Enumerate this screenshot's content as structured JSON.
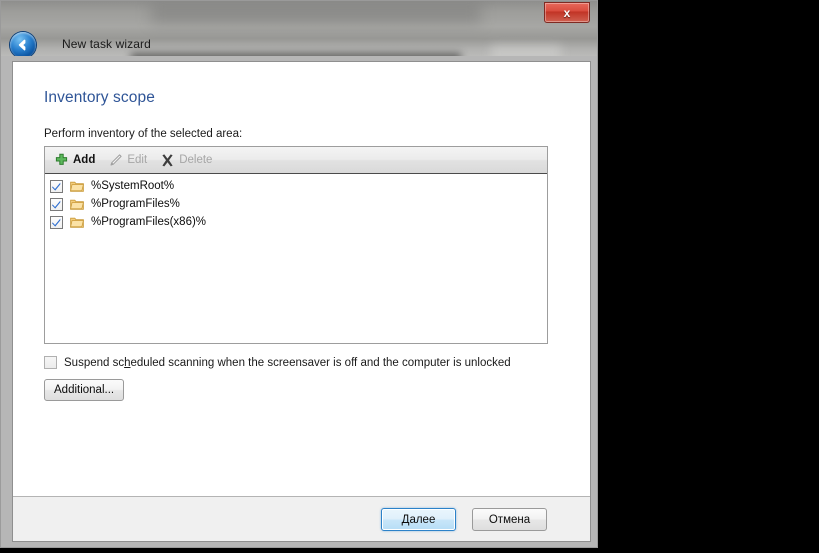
{
  "window": {
    "title": "New task wizard",
    "back_icon": "back-arrow-icon",
    "close_label": "x"
  },
  "page": {
    "heading": "Inventory scope",
    "section_label": "Perform inventory of the selected area:"
  },
  "toolbar": {
    "items": [
      {
        "label": "Add",
        "icon": "plus-icon",
        "enabled": true
      },
      {
        "label": "Edit",
        "icon": "pencil-icon",
        "enabled": false
      },
      {
        "label": "Delete",
        "icon": "cross-icon",
        "enabled": false
      }
    ]
  },
  "scope_list": {
    "rows": [
      {
        "label": "%SystemRoot%",
        "checked": true,
        "icon": "folder-icon"
      },
      {
        "label": "%ProgramFiles%",
        "checked": true,
        "icon": "folder-icon"
      },
      {
        "label": "%ProgramFiles(x86)%",
        "checked": true,
        "icon": "folder-icon"
      }
    ]
  },
  "options": {
    "suspend_text_before": "Suspend sc",
    "suspend_accel": "h",
    "suspend_text_after": "eduled scanning when the screensaver is off and the computer is unlocked",
    "suspend_checked": false,
    "additional_label": "Additional..."
  },
  "footer": {
    "next_accel": "Д",
    "next_rest": "алее",
    "cancel_label": "Отмена"
  },
  "colors": {
    "heading": "#2f5597",
    "accent": "#2c82c9",
    "close_red": "#c13325",
    "folder": "#f0c270",
    "plus_green": "#3a9b36"
  }
}
